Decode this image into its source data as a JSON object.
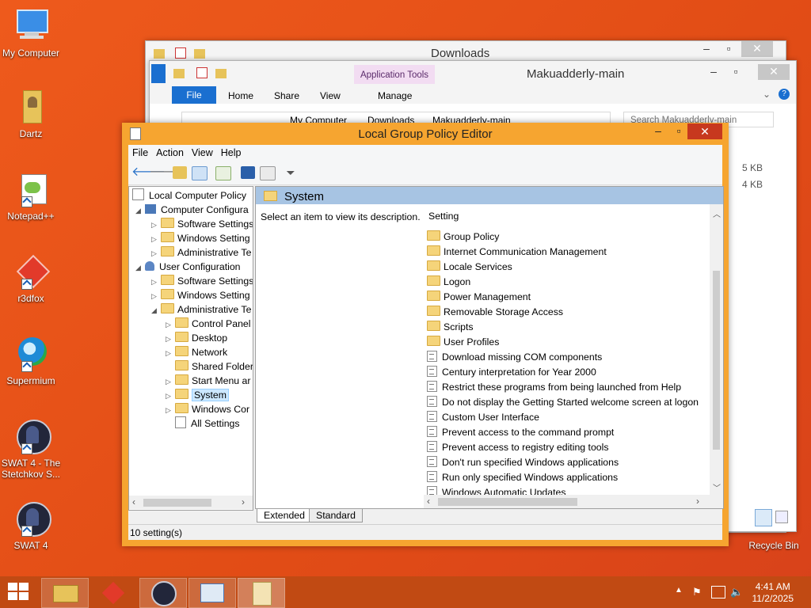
{
  "desktop": {
    "icons": [
      {
        "label": "My Computer"
      },
      {
        "label": "Dartz"
      },
      {
        "label": "Notepad++"
      },
      {
        "label": "r3dfox"
      },
      {
        "label": "Supermium"
      },
      {
        "label": "SWAT 4 - The Stetchkov S..."
      },
      {
        "label": "SWAT 4"
      }
    ],
    "recycle_bin": "Recycle Bin"
  },
  "explorer_back": {
    "title": "Downloads"
  },
  "explorer_front": {
    "title": "Makuadderly-main",
    "context_tab": "Application Tools",
    "ribbon_tabs": [
      "File",
      "Home",
      "Share",
      "View",
      "Manage"
    ],
    "address": [
      "My Computer",
      "Downloads",
      "Makuadderly-main"
    ],
    "search_placeholder": "Search Makuadderly-main",
    "sizes": [
      "5 KB",
      "4 KB"
    ]
  },
  "gpedit": {
    "title": "Local Group Policy Editor",
    "menu": [
      "File",
      "Action",
      "View",
      "Help"
    ],
    "tree": [
      {
        "label": "Local Computer Policy"
      },
      {
        "label": "Computer Configura"
      },
      {
        "label": "Software Settings"
      },
      {
        "label": "Windows Setting"
      },
      {
        "label": "Administrative Te"
      },
      {
        "label": "User Configuration"
      },
      {
        "label": "Software Settings"
      },
      {
        "label": "Windows Setting"
      },
      {
        "label": "Administrative Te"
      },
      {
        "label": "Control Panel"
      },
      {
        "label": "Desktop"
      },
      {
        "label": "Network"
      },
      {
        "label": "Shared Folder"
      },
      {
        "label": "Start Menu ar"
      },
      {
        "label": "System"
      },
      {
        "label": "Windows Cor"
      },
      {
        "label": "All Settings"
      }
    ],
    "section_title": "System",
    "description": "Select an item to view its description.",
    "column_header": "Setting",
    "settings": [
      {
        "label": "Group Policy",
        "kind": "folder"
      },
      {
        "label": "Internet Communication Management",
        "kind": "folder"
      },
      {
        "label": "Locale Services",
        "kind": "folder"
      },
      {
        "label": "Logon",
        "kind": "folder"
      },
      {
        "label": "Power Management",
        "kind": "folder"
      },
      {
        "label": "Removable Storage Access",
        "kind": "folder"
      },
      {
        "label": "Scripts",
        "kind": "folder"
      },
      {
        "label": "User Profiles",
        "kind": "folder"
      },
      {
        "label": "Download missing COM components",
        "kind": "setting"
      },
      {
        "label": "Century interpretation for Year 2000",
        "kind": "setting"
      },
      {
        "label": "Restrict these programs from being launched from Help",
        "kind": "setting"
      },
      {
        "label": "Do not display the Getting Started welcome screen at logon",
        "kind": "setting"
      },
      {
        "label": "Custom User Interface",
        "kind": "setting"
      },
      {
        "label": "Prevent access to the command prompt",
        "kind": "setting"
      },
      {
        "label": "Prevent access to registry editing tools",
        "kind": "setting"
      },
      {
        "label": "Don't run specified Windows applications",
        "kind": "setting"
      },
      {
        "label": "Run only specified Windows applications",
        "kind": "setting"
      },
      {
        "label": "Windows Automatic Updates",
        "kind": "setting"
      }
    ],
    "tabs": [
      "Extended",
      "Standard"
    ],
    "status": "10 setting(s)"
  },
  "taskbar": {
    "time": "4:41 AM",
    "date": "11/2/2025"
  },
  "colors": {
    "desktop": "#e8531a",
    "gp_frame": "#f6a530",
    "header_blue": "#a7c4e3",
    "close_red": "#c7381e"
  }
}
